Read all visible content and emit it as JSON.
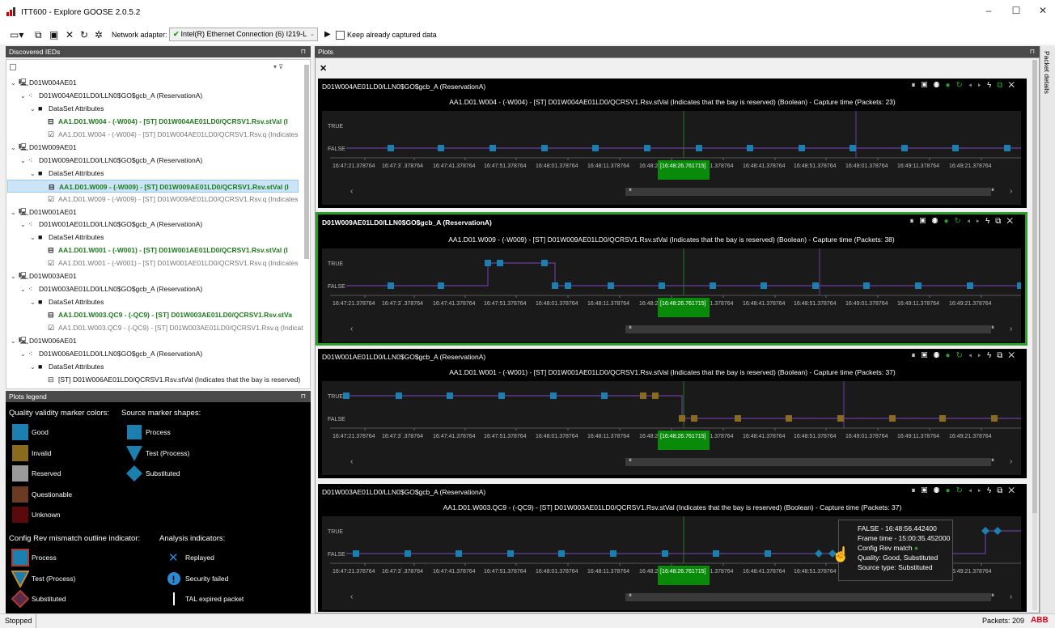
{
  "window": {
    "title": "ITT600 - Explore GOOSE 2.0.5.2",
    "minimize": "–",
    "maximize": "☐",
    "close": "✕"
  },
  "toolbar": {
    "network_adapter_label": "Network adapter:",
    "adapter_value": "Intel(R) Ethernet Connection (6) I219-L",
    "keep_label": "Keep already captured data"
  },
  "left_panel": {
    "title": "Discovered IEDs",
    "pin": "📌"
  },
  "tree": [
    {
      "label": "D01W004AE01",
      "level": 0,
      "icon": "device-icon",
      "exp": "v"
    },
    {
      "label": "D01W004AE01LD0/LLN0$GO$gcb_A (ReservationA)",
      "level": 1,
      "icon": "goose-icon",
      "exp": "v"
    },
    {
      "label": "DataSet Attributes",
      "level": 2,
      "icon": "folder-icon",
      "exp": "v"
    },
    {
      "label": "AA1.D01.W004 - (-W004) - [ST] D01W004AE01LD0/QCRSV1.Rsv.stVal (I",
      "level": 3,
      "icon": "signal-icon",
      "style": "gb"
    },
    {
      "label": "AA1.D01.W004 - (-W004) - [ST] D01W004AE01LD0/QCRSV1.Rsv.q (Indicates",
      "level": 3,
      "icon": "clipboard-icon",
      "style": "gr"
    },
    {
      "label": "D01W009AE01",
      "level": 0,
      "icon": "device-icon",
      "exp": "v"
    },
    {
      "label": "D01W009AE01LD0/LLN0$GO$gcb_A (ReservationA)",
      "level": 1,
      "icon": "goose-icon",
      "exp": "v"
    },
    {
      "label": "DataSet Attributes",
      "level": 2,
      "icon": "folder-icon",
      "exp": "v"
    },
    {
      "label": "AA1.D01.W009 - (-W009) - [ST] D01W009AE01LD0/QCRSV1.Rsv.stVal (I",
      "level": 3,
      "icon": "signal-icon",
      "style": "gb",
      "selected": true
    },
    {
      "label": "AA1.D01.W009 - (-W009) - [ST] D01W009AE01LD0/QCRSV1.Rsv.q (Indicates",
      "level": 3,
      "icon": "clipboard-icon",
      "style": "gr"
    },
    {
      "label": "D01W001AE01",
      "level": 0,
      "icon": "device-icon",
      "exp": "v"
    },
    {
      "label": "D01W001AE01LD0/LLN0$GO$gcb_A (ReservationA)",
      "level": 1,
      "icon": "goose-icon",
      "exp": "v"
    },
    {
      "label": "DataSet Attributes",
      "level": 2,
      "icon": "folder-icon",
      "exp": "v"
    },
    {
      "label": "AA1.D01.W001 - (-W001) - [ST] D01W001AE01LD0/QCRSV1.Rsv.stVal (I",
      "level": 3,
      "icon": "signal-icon",
      "style": "gb"
    },
    {
      "label": "AA1.D01.W001 - (-W001) - [ST] D01W001AE01LD0/QCRSV1.Rsv.q (Indicates",
      "level": 3,
      "icon": "clipboard-icon",
      "style": "gr"
    },
    {
      "label": "D01W003AE01",
      "level": 0,
      "icon": "device-icon",
      "exp": "v"
    },
    {
      "label": "D01W003AE01LD0/LLN0$GO$gcb_A (ReservationA)",
      "level": 1,
      "icon": "goose-icon",
      "exp": "v"
    },
    {
      "label": "DataSet Attributes",
      "level": 2,
      "icon": "folder-icon",
      "exp": "v"
    },
    {
      "label": "AA1.D01.W003.QC9 - (-QC9) - [ST] D01W003AE01LD0/QCRSV1.Rsv.stVa",
      "level": 3,
      "icon": "signal-icon",
      "style": "gb"
    },
    {
      "label": "AA1.D01.W003.QC9 - (-QC9) - [ST] D01W003AE01LD0/QCRSV1.Rsv.q (Indicat",
      "level": 3,
      "icon": "clipboard-icon",
      "style": "gr"
    },
    {
      "label": "D01W006AE01",
      "level": 0,
      "icon": "device-icon",
      "exp": "v"
    },
    {
      "label": "D01W006AE01LD0/LLN0$GO$gcb_A (ReservationA)",
      "level": 1,
      "icon": "goose-icon",
      "exp": "v"
    },
    {
      "label": "DataSet Attributes",
      "level": 2,
      "icon": "folder-icon",
      "exp": "v"
    },
    {
      "label": "[ST] D01W006AE01LD0/QCRSV1.Rsv.stVal (Indicates that the bay is reserved)",
      "level": 3,
      "icon": "signal-icon"
    }
  ],
  "legend": {
    "title": "Plots legend",
    "quality_title": "Quality validity marker colors:",
    "source_title": "Source marker shapes:",
    "quality": [
      {
        "label": "Good",
        "color": "#1b7fb0"
      },
      {
        "label": "Invalid",
        "color": "#8a6a1e"
      },
      {
        "label": "Reserved",
        "color": "#9a9a9a"
      },
      {
        "label": "Questionable",
        "color": "#6a3a22"
      },
      {
        "label": "Unknown",
        "color": "#5a0a0a"
      }
    ],
    "source": [
      {
        "label": "Process",
        "shape": "square"
      },
      {
        "label": "Test (Process)",
        "shape": "triangle"
      },
      {
        "label": "Substituted",
        "shape": "diamond"
      }
    ],
    "config_title": "Config Rev mismatch outline indicator:",
    "analysis_title": "Analysis indicators:",
    "config": [
      {
        "label": "Process"
      },
      {
        "label": "Test (Process)"
      },
      {
        "label": "Substituted"
      }
    ],
    "analysis": [
      {
        "label": "Replayed",
        "icon": "x-icon"
      },
      {
        "label": "Security failed",
        "icon": "exclamation-icon"
      },
      {
        "label": "TAL expired packet",
        "icon": "bar-icon"
      }
    ]
  },
  "plots_panel": {
    "title": "Plots",
    "close": "✕",
    "side_tab": "Packet details"
  },
  "time_ticks": [
    "16:47:21.378764",
    "16:47:3`.378764",
    "16:47:41.378764",
    "16:47:51.378764",
    "16:48:01.378764",
    "16:48:11.378764",
    "16:48:21",
    "16:48:31.378764",
    "16:48:41.378764",
    "16:48:51.378764",
    "16:49:01.378764",
    "16:49:11.378764",
    "16:49:21.378764"
  ],
  "cursor_time": "[16:48:26.761715]",
  "y_labels": {
    "true": "TRUE",
    "false": "FALSE"
  },
  "plots": [
    {
      "title": "D01W004AE01LD0/LLN0$GO$gcb_A (ReservationA)",
      "subtitle": "AA1.D01.W004 - (-W004) - [ST] D01W004AE01LD0/QCRSV1.Rsv.stVal (Indicates that the bay is reserved) (Boolean) - Capture time (Packets: 23)"
    },
    {
      "title": "D01W009AE01LD0/LLN0$GO$gcb_A (ReservationA)",
      "subtitle": "AA1.D01.W009 - (-W009) - [ST] D01W009AE01LD0/QCRSV1.Rsv.stVal (Indicates that the bay is reserved) (Boolean) - Capture time (Packets: 38)"
    },
    {
      "title": "D01W001AE01LD0/LLN0$GO$gcb_A (ReservationA)",
      "subtitle": "AA1.D01.W001 - (-W001) - [ST] D01W001AE01LD0/QCRSV1.Rsv.stVal (Indicates that the bay is reserved) (Boolean) - Capture time (Packets: 37)"
    },
    {
      "title": "D01W003AE01LD0/LLN0$GO$gcb_A (ReservationA)",
      "subtitle": "AA1.D01.W003.QC9 - (-QC9) - [ST] D01W003AE01LD0/QCRSV1.Rsv.stVal (Indicates that the bay is reserved) (Boolean) - Capture time (Packets: 37)"
    }
  ],
  "tooltip": {
    "line1": "FALSE - 16:48:56.442400",
    "line2": "Frame time - 15:00:35.452000",
    "line3": "Config Rev match",
    "line4": "Quality: Good, Substituted",
    "line5": "Source type: Substituted"
  },
  "status": {
    "left": "Stopped",
    "packets": "Packets: 209",
    "brand": "ABB"
  },
  "colors": {
    "good": "#1b7fb0",
    "invalid": "#8a6a1e",
    "line": "#6a3da0",
    "cursor": "#1f7a1f",
    "active": "#2aa02a"
  }
}
